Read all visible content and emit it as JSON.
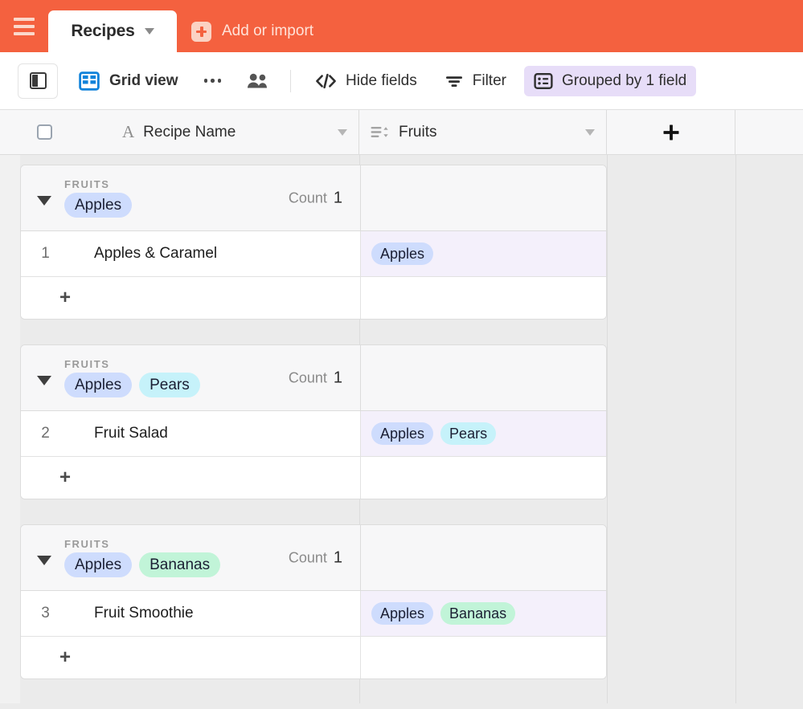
{
  "topbar": {
    "menu_icon": "hamburger-icon",
    "tab_label": "Recipes",
    "tab_caret_icon": "chevron-down-icon",
    "add_icon": "plus-square-icon",
    "add_label": "Add or import",
    "bg_color": "#f4613f"
  },
  "toolbar": {
    "sidebar_toggle_icon": "sidebar-panel-icon",
    "grid_icon": "grid-table-icon",
    "view_name": "Grid view",
    "more_icon": "ellipsis-icon",
    "collaborators_icon": "people-icon",
    "hide_fields_icon": "code-brackets-icon",
    "hide_fields_label": "Hide fields",
    "filter_icon": "funnel-icon",
    "filter_label": "Filter",
    "group_icon": "list-panel-icon",
    "group_label": "Grouped by 1 field",
    "group_badge_color": "#e7ddf8",
    "grid_icon_color": "#1283da"
  },
  "table": {
    "select_all_checkbox": "",
    "columns": [
      {
        "name": "Recipe Name",
        "type_icon": "text-type-icon",
        "caret_icon": "chevron-down-icon"
      },
      {
        "name": "Fruits",
        "type_icon": "multiselect-type-icon",
        "caret_icon": "chevron-down-icon"
      }
    ],
    "add_field_icon": "plus-icon",
    "group_field_label": "FRUITS",
    "count_label": "Count",
    "add_record_icon": "plus-icon"
  },
  "tag_colors": {
    "Apples": "#cedcfd",
    "Pears": "#c6f2fa",
    "Bananas": "#c1f4d8"
  },
  "groups": [
    {
      "field_label": "FRUITS",
      "tags": [
        "Apples"
      ],
      "count_label": "Count",
      "count": "1",
      "collapse_icon": "triangle-down-icon",
      "rows": [
        {
          "num": "1",
          "name": "Apples & Caramel",
          "fruits": [
            "Apples"
          ]
        }
      ]
    },
    {
      "field_label": "FRUITS",
      "tags": [
        "Apples",
        "Pears"
      ],
      "count_label": "Count",
      "count": "1",
      "collapse_icon": "triangle-down-icon",
      "rows": [
        {
          "num": "2",
          "name": "Fruit Salad",
          "fruits": [
            "Apples",
            "Pears"
          ]
        }
      ]
    },
    {
      "field_label": "FRUITS",
      "tags": [
        "Apples",
        "Bananas"
      ],
      "count_label": "Count",
      "count": "1",
      "collapse_icon": "triangle-down-icon",
      "rows": [
        {
          "num": "3",
          "name": "Fruit Smoothie",
          "fruits": [
            "Apples",
            "Bananas"
          ]
        }
      ]
    }
  ]
}
